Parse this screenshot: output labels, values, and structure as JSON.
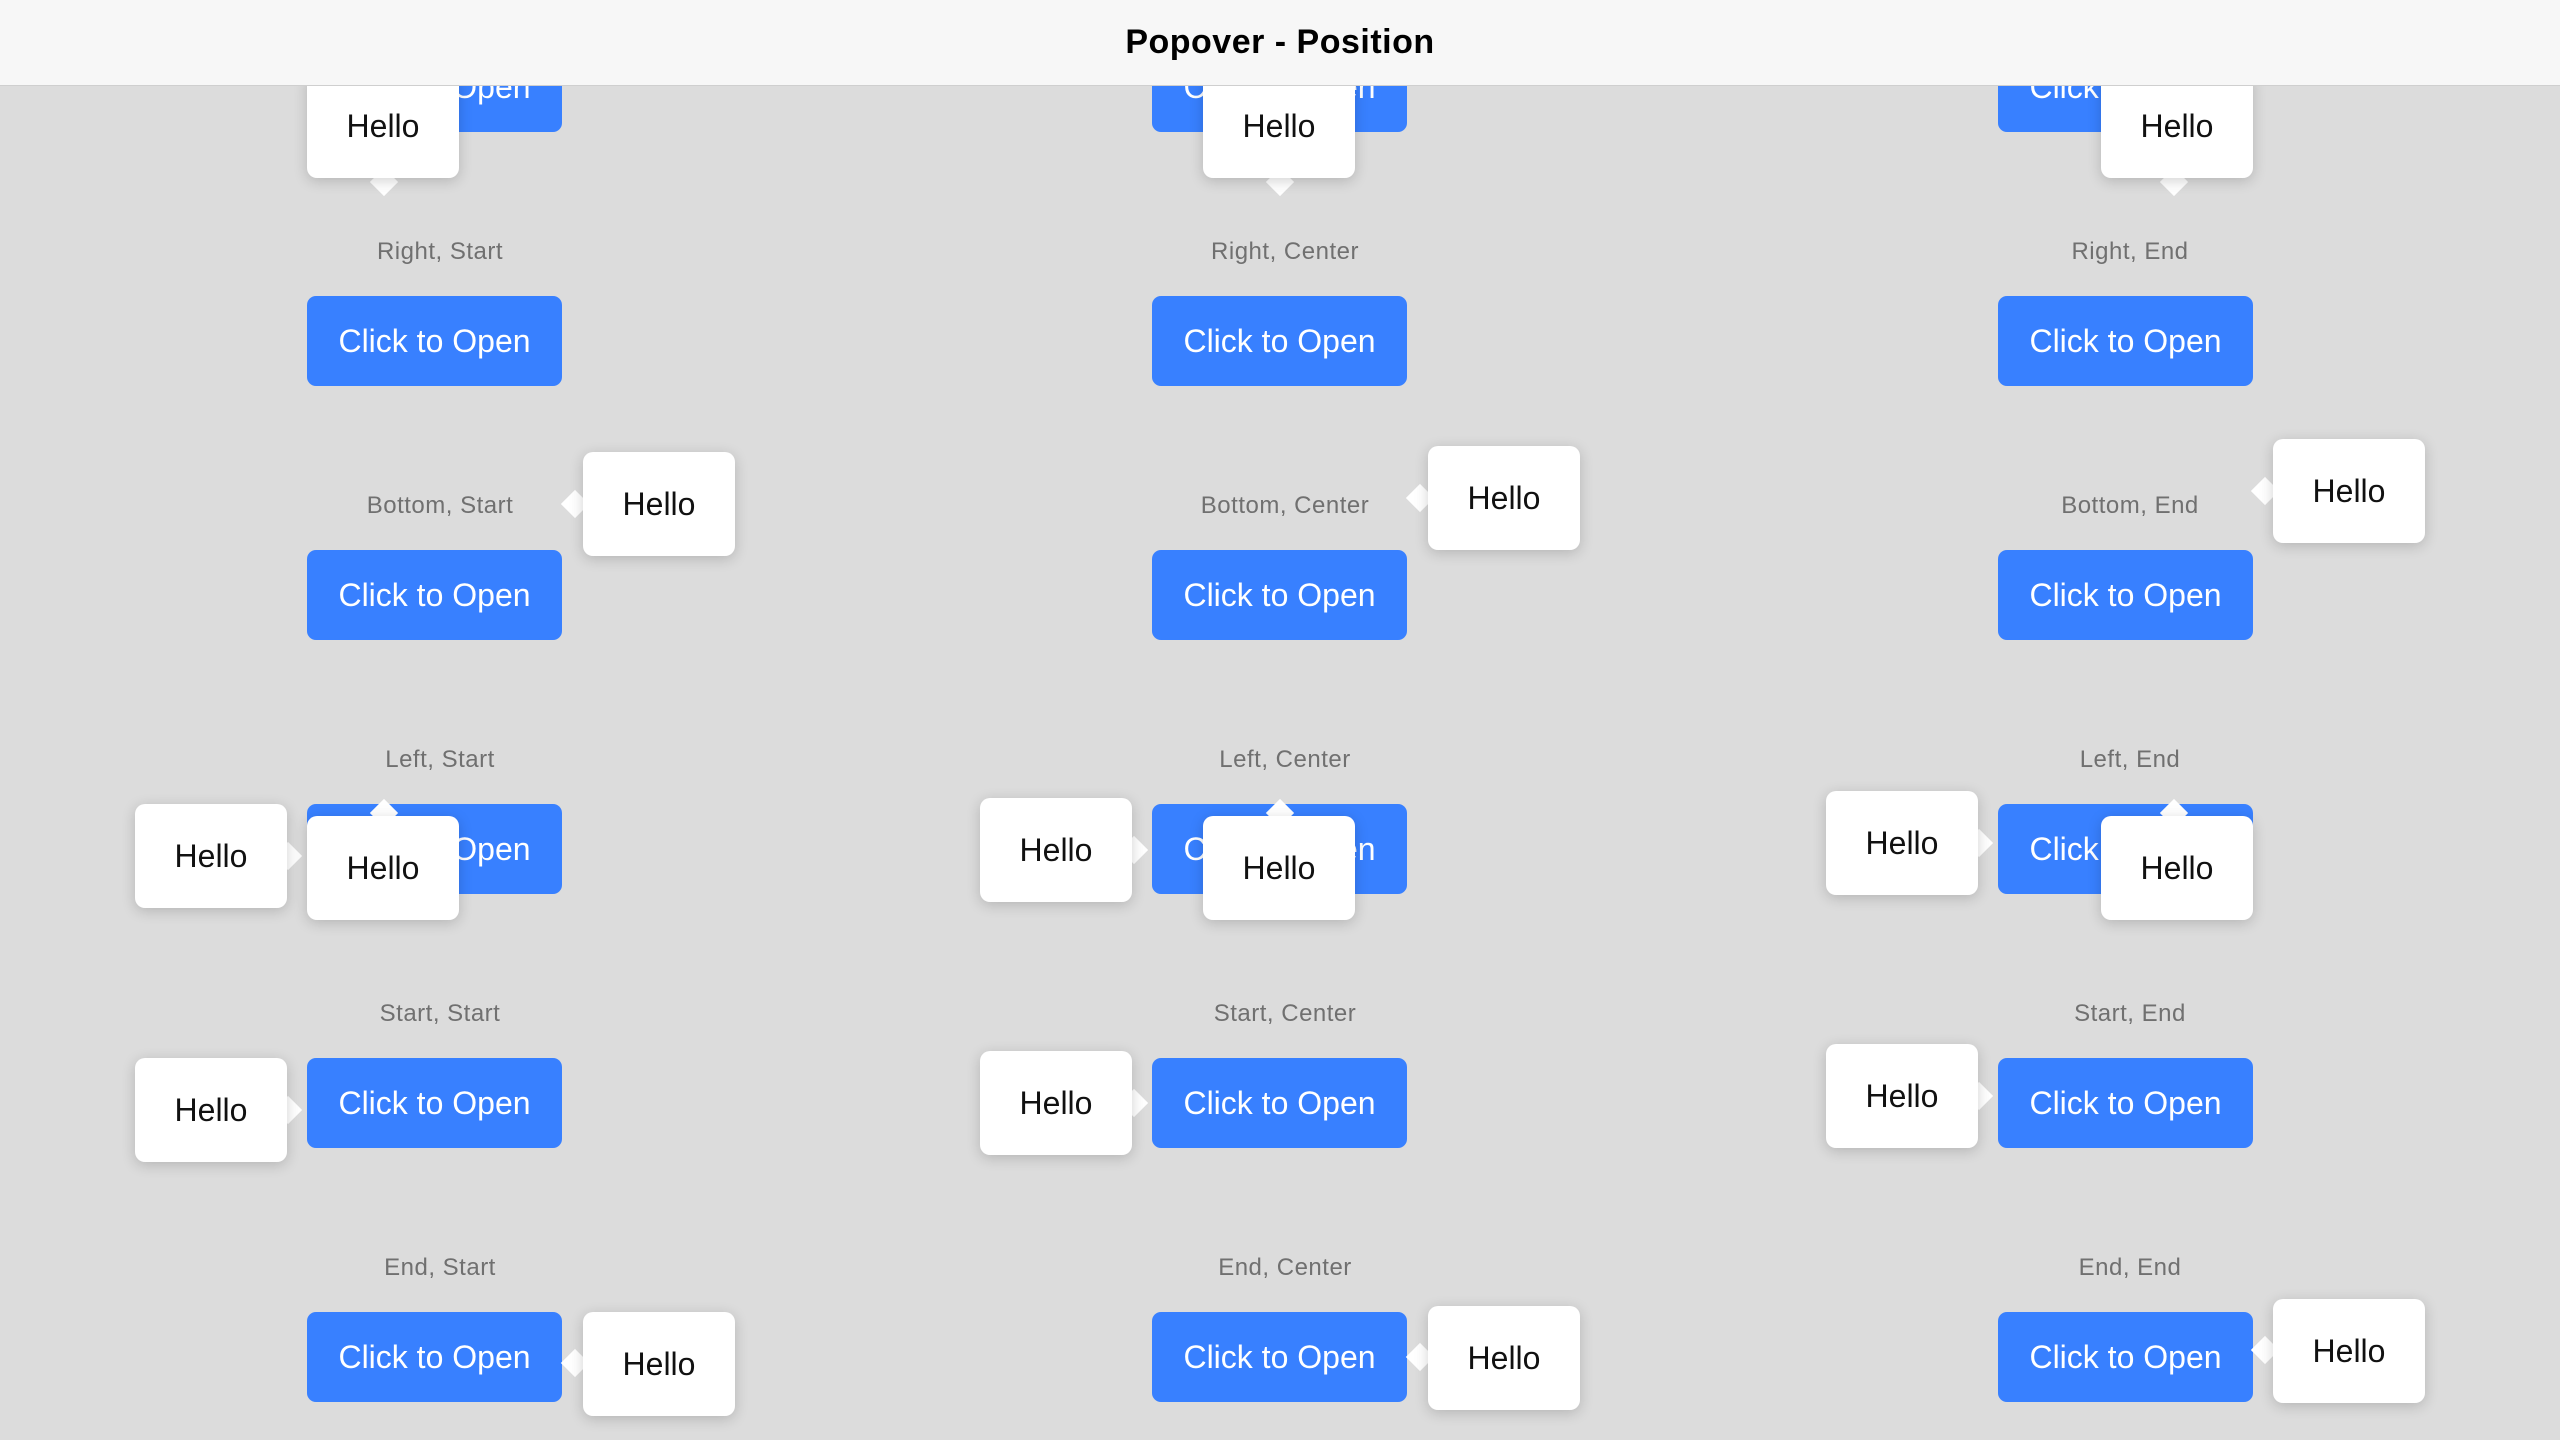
{
  "header": {
    "title": "Popover - Position"
  },
  "button_label": "Click to Open",
  "popover_text": "Hello",
  "colors": {
    "accent": "#3880ff",
    "background": "#dcdcdc",
    "header_bg": "#f7f7f7",
    "label": "#707070"
  },
  "groups": [
    {
      "label": "Right, Start"
    },
    {
      "label": "Right, Center"
    },
    {
      "label": "Right, End"
    },
    {
      "label": "Bottom, Start"
    },
    {
      "label": "Bottom, Center"
    },
    {
      "label": "Bottom, End"
    },
    {
      "label": "Left, Start"
    },
    {
      "label": "Left, Center"
    },
    {
      "label": "Left, End"
    },
    {
      "label": "Start, Start"
    },
    {
      "label": "Start, Center"
    },
    {
      "label": "Start, End"
    },
    {
      "label": "End, Start"
    },
    {
      "label": "End, Center"
    },
    {
      "label": "End, End"
    }
  ]
}
